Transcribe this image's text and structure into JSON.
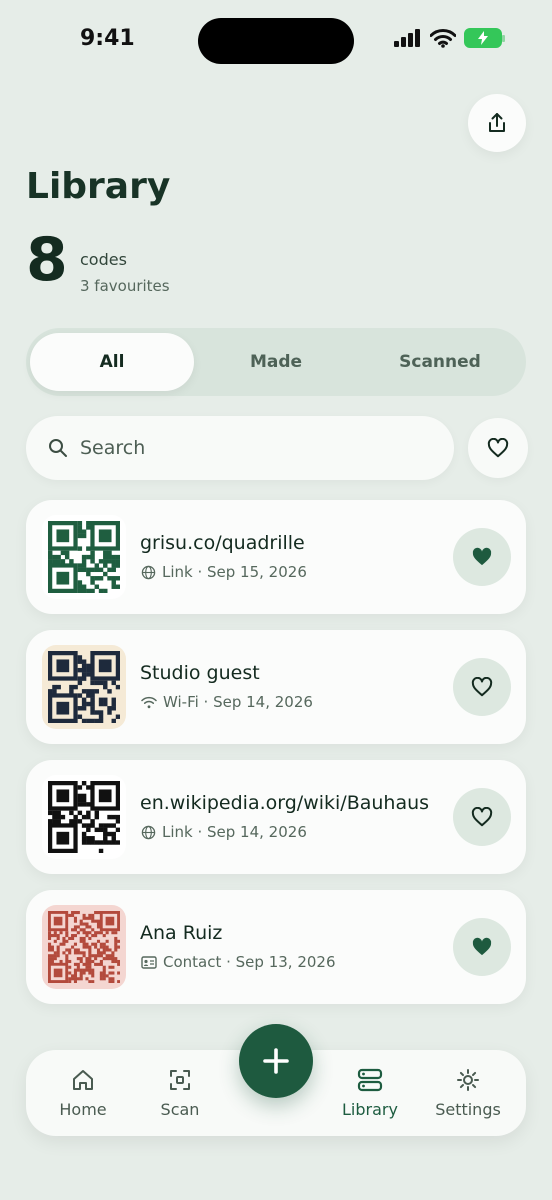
{
  "status": {
    "time": "9:41"
  },
  "header": {
    "title": "Library",
    "count": "8",
    "count_label": "codes",
    "favourites_label": "3 favourites"
  },
  "segments": [
    "All",
    "Made",
    "Scanned"
  ],
  "search": {
    "placeholder": "Search"
  },
  "items": [
    {
      "title": "grisu.co/quadrille",
      "type_icon": "globe-icon",
      "meta": "Link · Sep 15, 2026",
      "favourite": true,
      "qr_color": "#1f5e40",
      "thumb_bg": "#ffffff"
    },
    {
      "title": "Studio guest",
      "type_icon": "wifi-icon",
      "meta": "Wi-Fi · Sep 14, 2026",
      "favourite": false,
      "qr_color": "#1e2a3c",
      "thumb_bg": "#f5ead6"
    },
    {
      "title": "en.wikipedia.org/wiki/Bauhaus",
      "type_icon": "globe-icon",
      "meta": "Link · Sep 14, 2026",
      "favourite": false,
      "qr_color": "#111111",
      "thumb_bg": "#ffffff"
    },
    {
      "title": "Ana Ruiz",
      "type_icon": "contact-card-icon",
      "meta": "Contact · Sep 13, 2026",
      "favourite": true,
      "qr_color": "#b34a3c",
      "thumb_bg": "#f4d6d1"
    }
  ],
  "tabs": [
    {
      "label": "Home",
      "icon": "home-icon"
    },
    {
      "label": "Scan",
      "icon": "scan-icon"
    },
    {
      "label": "Library",
      "icon": "library-icon"
    },
    {
      "label": "Settings",
      "icon": "gear-icon"
    }
  ],
  "colors": {
    "accent": "#1e5a3f",
    "background": "#e6ede8"
  }
}
